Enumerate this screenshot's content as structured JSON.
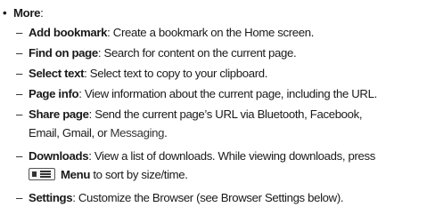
{
  "bullet": {
    "symbol": "•",
    "heading": "More",
    "suffix": ":"
  },
  "items": [
    {
      "dash": "–",
      "term": "Add bookmark",
      "sep": ":",
      "text": " Create a bookmark on the Home screen."
    },
    {
      "dash": "–",
      "term": "Find on page",
      "sep": ":",
      "text": " Search for content on the current page."
    },
    {
      "dash": "–",
      "term": "Select text",
      "sep": ":",
      "text": " Select text to copy to your clipboard."
    },
    {
      "dash": "–",
      "term": "Page info",
      "sep": ":",
      "text": " View information about the current page, including the URL."
    },
    {
      "dash": "–",
      "term": "Share page",
      "sep": ":",
      "text": " Send the current page’s URL via Bluetooth, Facebook,",
      "line2_a": "Email, Gmail, or ",
      "line2_b": "Messaging",
      "line2_c": "."
    },
    {
      "dash": "–",
      "term": "Downloads",
      "sep": ":",
      "text": " View a list of downloads. While viewing downloads, press",
      "line2_icon": "menu-key-icon",
      "line2_bold": "Menu",
      "line2_text": " to sort by size/time."
    },
    {
      "dash": "–",
      "term": "Settings",
      "sep": ":",
      "text": " Customize the Browser (see Browser Settings below)."
    }
  ]
}
